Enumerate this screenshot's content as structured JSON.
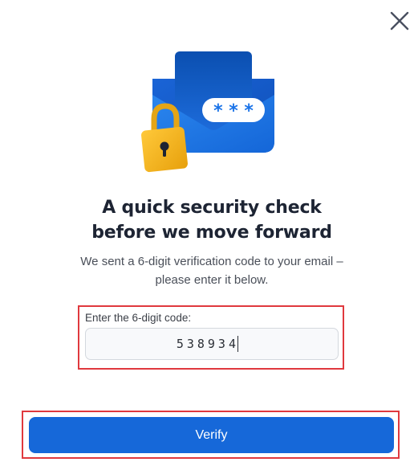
{
  "dialog": {
    "title_line1": "A quick security check",
    "title_line2": "before we move forward",
    "subtitle_line1": "We sent a 6-digit verification code to your email –",
    "subtitle_line2": "please enter it below."
  },
  "code_field": {
    "label": "Enter the 6-digit code:",
    "value": "538934"
  },
  "verify_button": {
    "label": "Verify"
  },
  "icons": {
    "close": "close-icon",
    "illustration": "envelope-lock-password-icon"
  },
  "colors": {
    "primary": "#1668d9",
    "highlight_border": "#e0393e",
    "title_text": "#1d2433",
    "lock_gold": "#f2b418",
    "envelope_blue": "#1a73e8"
  }
}
